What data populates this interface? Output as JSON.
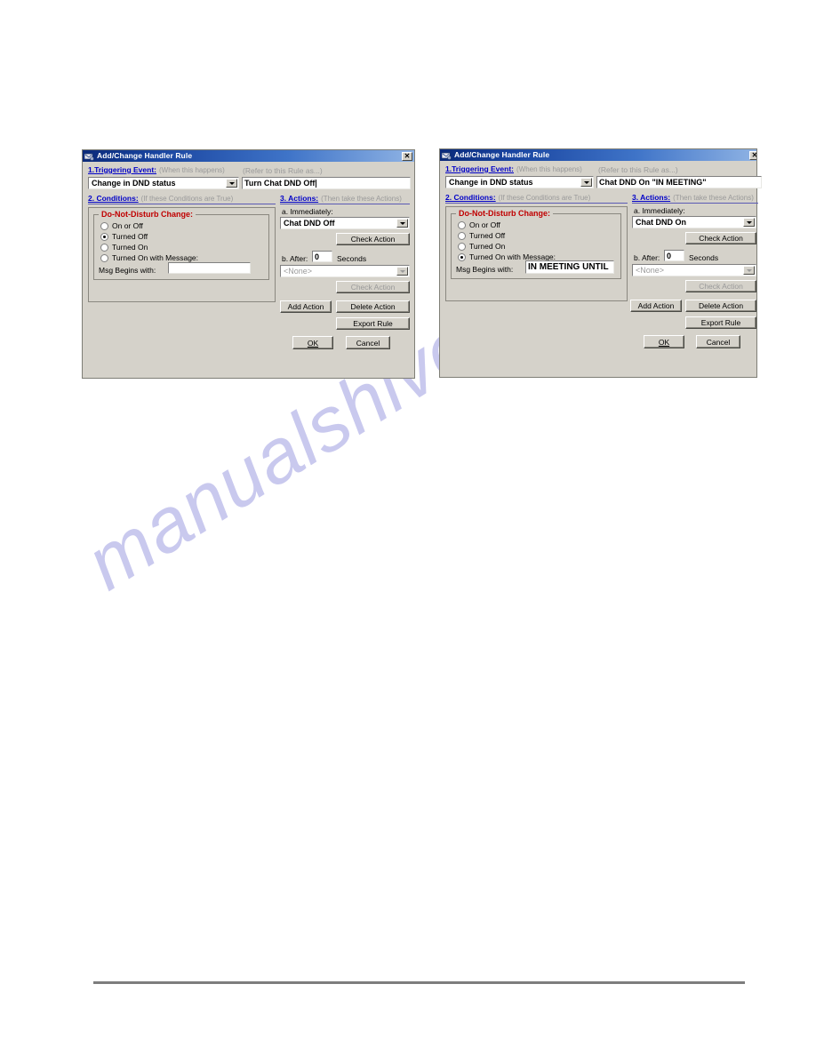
{
  "page": {
    "watermark": "manualshive.com"
  },
  "dialogs": [
    {
      "id": "left",
      "title": "Add/Change Handler Rule",
      "close_label": "✕",
      "sections": {
        "triggering": {
          "num": "1.Triggering Event:",
          "hint": "(When this happens)",
          "rule_as_hint": "(Refer to this Rule as...)",
          "event_value": "Change in DND status",
          "rule_name_value": "Turn Chat DND Off"
        },
        "conditions": {
          "num": "2. Conditions:",
          "hint": "(If these Conditions are True)",
          "group_title": "Do-Not-Disturb Change:",
          "radios": [
            {
              "label": "On or Off",
              "checked": false
            },
            {
              "label": "Turned Off",
              "checked": true
            },
            {
              "label": "Turned On",
              "checked": false
            },
            {
              "label": "Turned On with Message:",
              "checked": false
            }
          ],
          "msg_label": "Msg Begins with:",
          "msg_value": ""
        },
        "actions": {
          "num": "3. Actions:",
          "hint": "(Then take these Actions)",
          "immediately_label": "a. Immediately:",
          "immediately_value": "Chat DND Off",
          "check_action_a": "Check Action",
          "after_label": "b. After:",
          "after_value": "0",
          "seconds_label": "Seconds",
          "delayed_value": "<None>",
          "check_action_b": "Check Action",
          "add_action": "Add Action",
          "delete_action": "Delete Action",
          "export_rule": "Export Rule",
          "ok": "OK",
          "cancel": "Cancel"
        }
      }
    },
    {
      "id": "right",
      "title": "Add/Change Handler Rule",
      "close_label": "✕",
      "sections": {
        "triggering": {
          "num": "1.Triggering Event:",
          "hint": "(When this happens)",
          "rule_as_hint": "(Refer to this Rule as...)",
          "event_value": "Change in DND status",
          "rule_name_value": "Chat DND On \"IN MEETING\""
        },
        "conditions": {
          "num": "2. Conditions:",
          "hint": "(If these Conditions are True)",
          "group_title": "Do-Not-Disturb Change:",
          "radios": [
            {
              "label": "On or Off",
              "checked": false
            },
            {
              "label": "Turned Off",
              "checked": false
            },
            {
              "label": "Turned On",
              "checked": false
            },
            {
              "label": "Turned On with Message:",
              "checked": true
            }
          ],
          "msg_label": "Msg Begins with:",
          "msg_value": "IN MEETING UNTIL"
        },
        "actions": {
          "num": "3. Actions:",
          "hint": "(Then take these Actions)",
          "immediately_label": "a. Immediately:",
          "immediately_value": "Chat DND On",
          "check_action_a": "Check Action",
          "after_label": "b. After:",
          "after_value": "0",
          "seconds_label": "Seconds",
          "delayed_value": "<None>",
          "check_action_b": "Check Action",
          "add_action": "Add Action",
          "delete_action": "Delete Action",
          "export_rule": "Export Rule",
          "ok": "OK",
          "cancel": "Cancel"
        }
      }
    }
  ]
}
